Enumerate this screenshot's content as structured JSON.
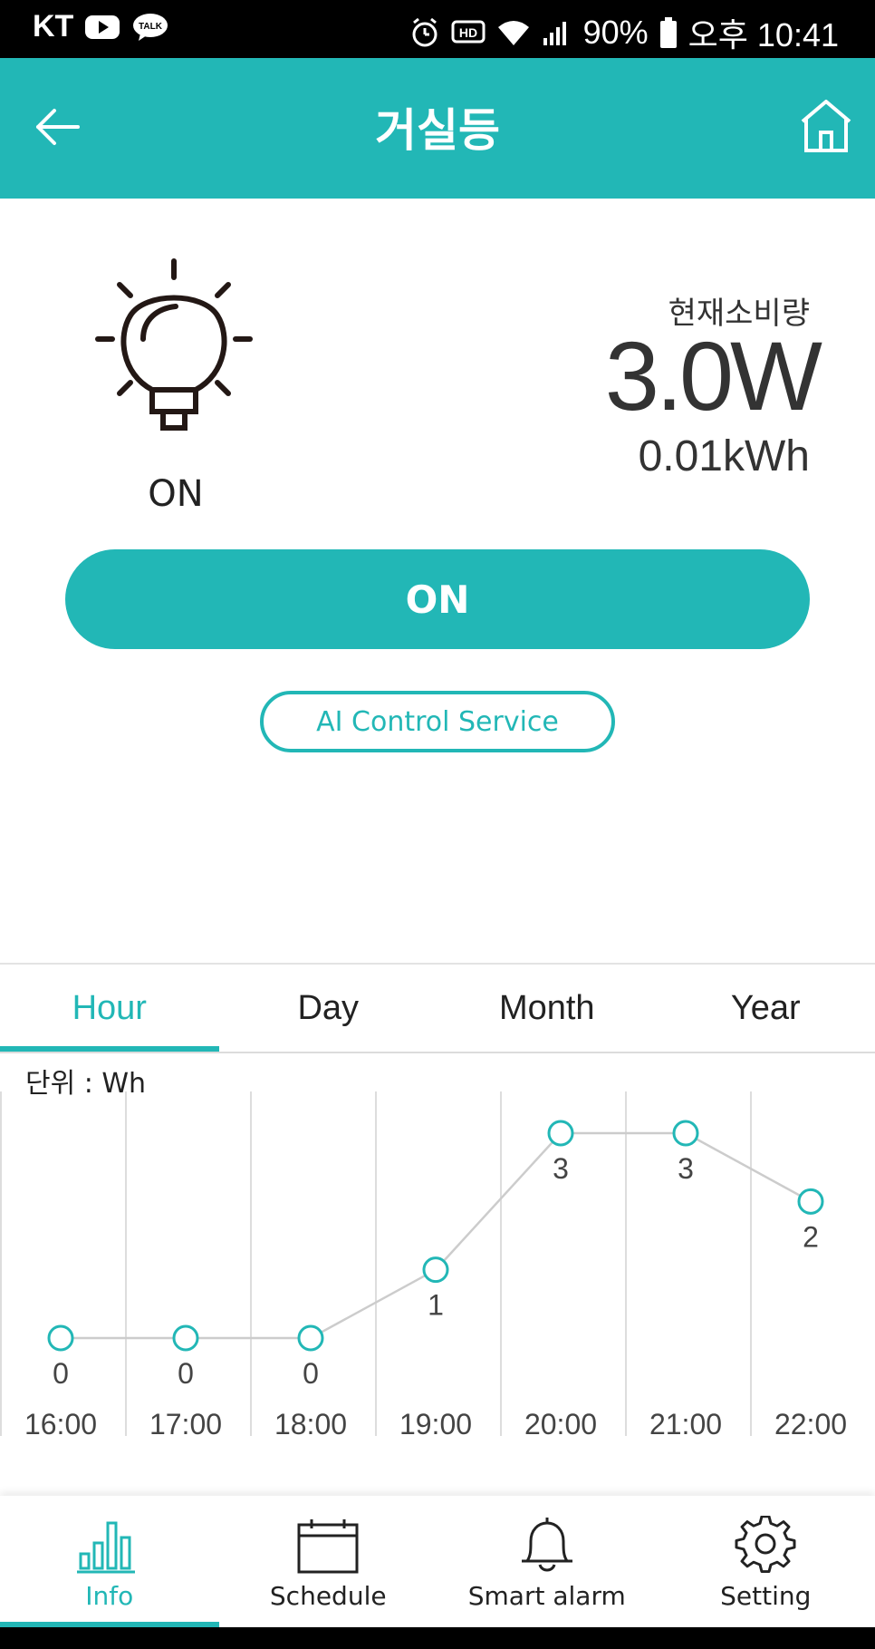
{
  "status_bar": {
    "carrier": "KT",
    "battery": "90%",
    "time": "오후 10:41"
  },
  "header": {
    "title": "거실등"
  },
  "device": {
    "state": "ON",
    "usage_label": "현재소비량",
    "power": "3.0W",
    "energy": "0.01kWh"
  },
  "controls": {
    "toggle_label": "ON",
    "ai_label": "AI Control Service"
  },
  "tabs": [
    "Hour",
    "Day",
    "Month",
    "Year"
  ],
  "active_tab": "Hour",
  "unit_label": "단위 : Wh",
  "chart_data": {
    "type": "line",
    "x": [
      "16:00",
      "17:00",
      "18:00",
      "19:00",
      "20:00",
      "21:00",
      "22:00"
    ],
    "values": [
      0,
      0,
      0,
      1,
      3,
      3,
      2
    ],
    "ylim": [
      0,
      3
    ],
    "grid": "vertical",
    "colors": {
      "line": "#cccccc",
      "marker": "#22b7b6",
      "grid": "#dddddd"
    }
  },
  "bottom_nav": [
    {
      "label": "Info",
      "icon": "bar-chart-icon"
    },
    {
      "label": "Schedule",
      "icon": "calendar-icon"
    },
    {
      "label": "Smart alarm",
      "icon": "bell-icon"
    },
    {
      "label": "Setting",
      "icon": "gear-icon"
    }
  ],
  "colors": {
    "accent": "#22b7b6",
    "text": "#222222"
  }
}
